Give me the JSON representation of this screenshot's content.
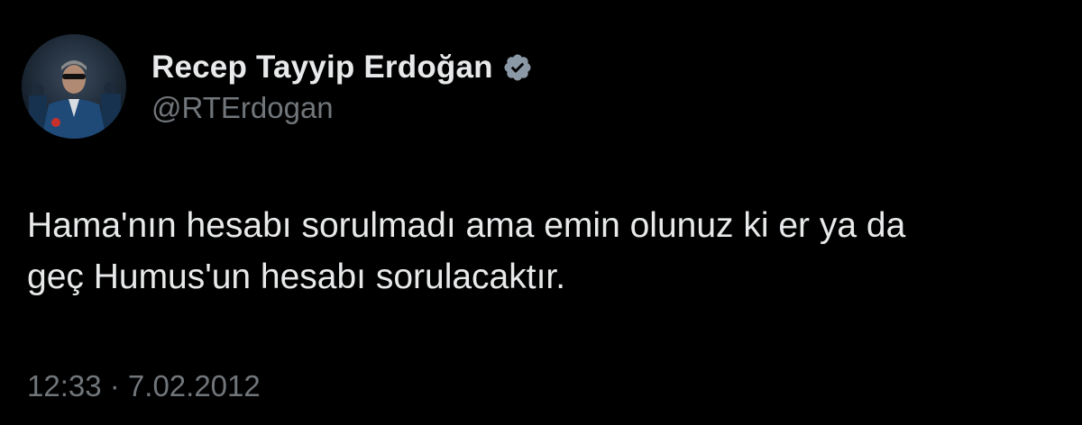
{
  "author": {
    "display_name": "Recep Tayyip Erdoğan",
    "handle": "@RTErdogan",
    "verified": true,
    "verified_icon": "verified-badge-icon"
  },
  "tweet": {
    "text": "Hama'nın hesabı sorulmadı ama emin olunuz ki er ya da\ngeç Humus'un hesabı sorulacaktır.",
    "time": "12:33",
    "separator": " · ",
    "date": "7.02.2012"
  },
  "colors": {
    "background": "#000000",
    "primary_text": "#e7e9ea",
    "secondary_text": "#71767b",
    "badge": "#8b98a5"
  }
}
